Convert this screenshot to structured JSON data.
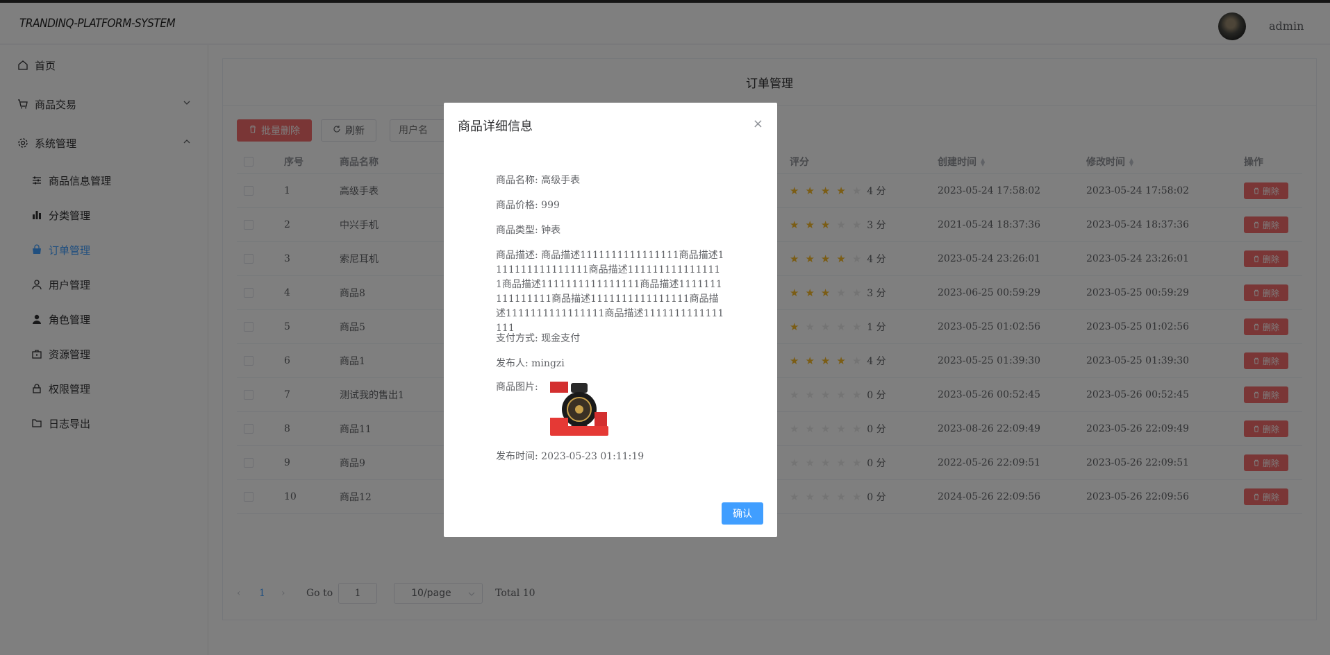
{
  "app": {
    "logo": "TRANDINQ-PLATFORM-SYSTEM",
    "username": "admin"
  },
  "sidebar": {
    "items": [
      {
        "label": "首页",
        "icon": "home-icon"
      },
      {
        "label": "商品交易",
        "icon": "cart-icon"
      },
      {
        "label": "系统管理",
        "icon": "gear-icon"
      },
      {
        "label": "商品信息管理",
        "icon": "sliders-icon"
      },
      {
        "label": "分类管理",
        "icon": "bar-chart-icon"
      },
      {
        "label": "订单管理",
        "icon": "shopping-bag-icon",
        "active": true
      },
      {
        "label": "用户管理",
        "icon": "user-icon"
      },
      {
        "label": "角色管理",
        "icon": "user-solid-icon"
      },
      {
        "label": "资源管理",
        "icon": "suitcase-icon"
      },
      {
        "label": "权限管理",
        "icon": "lock-icon"
      },
      {
        "label": "日志导出",
        "icon": "folder-icon"
      }
    ]
  },
  "main": {
    "title": "订单管理",
    "toolbar": {
      "batch_delete": "批量删除",
      "refresh": "刷新",
      "search_placeholder": "用户名"
    }
  },
  "table": {
    "columns": [
      "序号",
      "商品名称",
      "评分",
      "创建时间",
      "修改时间",
      "操作"
    ],
    "delete_label": "删除",
    "score_suffix": "分",
    "rows": [
      {
        "no": "1",
        "name": "高级手表",
        "rating": 4,
        "created": "2023-05-24 17:58:02",
        "modified": "2023-05-24 17:58:02"
      },
      {
        "no": "2",
        "name": "中兴手机",
        "rating": 3,
        "created": "2021-05-24 18:37:36",
        "modified": "2023-05-24 18:37:36"
      },
      {
        "no": "3",
        "name": "索尼耳机",
        "rating": 4,
        "created": "2023-05-24 23:26:01",
        "modified": "2023-05-24 23:26:01"
      },
      {
        "no": "4",
        "name": "商品8",
        "rating": 3,
        "created": "2023-06-25 00:59:29",
        "modified": "2023-05-25 00:59:29"
      },
      {
        "no": "5",
        "name": "商品5",
        "rating": 1,
        "created": "2023-05-25 01:02:56",
        "modified": "2023-05-25 01:02:56"
      },
      {
        "no": "6",
        "name": "商品1",
        "rating": 4,
        "created": "2023-05-25 01:39:30",
        "modified": "2023-05-25 01:39:30"
      },
      {
        "no": "7",
        "name": "测试我的售出1",
        "rating": 0,
        "created": "2023-05-26 00:52:45",
        "modified": "2023-05-26 00:52:45"
      },
      {
        "no": "8",
        "name": "商品11",
        "rating": 0,
        "created": "2023-08-26 22:09:49",
        "modified": "2023-05-26 22:09:49"
      },
      {
        "no": "9",
        "name": "商品9",
        "rating": 0,
        "created": "2022-05-26 22:09:51",
        "modified": "2023-05-26 22:09:51"
      },
      {
        "no": "10",
        "name": "商品12",
        "rating": 0,
        "created": "2024-05-26 22:09:56",
        "modified": "2023-05-26 22:09:56"
      }
    ]
  },
  "pagination": {
    "current": "1",
    "goto_label": "Go to",
    "goto_value": "1",
    "page_size": "10/page",
    "total": "Total 10"
  },
  "dialog": {
    "title": "商品详细信息",
    "name_label": "商品名称:",
    "name_value": "高级手表",
    "price_label": "商品价格:",
    "price_value": "999",
    "type_label": "商品类型:",
    "type_value": "钟表",
    "desc_label": "商品描述:",
    "desc_value": "商品描述1111111111111111商品描述1111111111111111商品描述1111111111111111商品描述1111111111111111商品描述1111111111111111商品描述1111111111111111商品描述1111111111111111商品描述1111111111111111",
    "pay_label": "支付方式:",
    "pay_value": "现金支付",
    "publisher_label": "发布人:",
    "publisher_value": "mingzi",
    "image_label": "商品图片:",
    "time_label": "发布时间:",
    "time_value": "2023-05-23 01:11:19",
    "confirm": "确认"
  },
  "colors": {
    "primary": "#409eff",
    "danger": "#f56c6c",
    "star": "#f7ba2a"
  }
}
